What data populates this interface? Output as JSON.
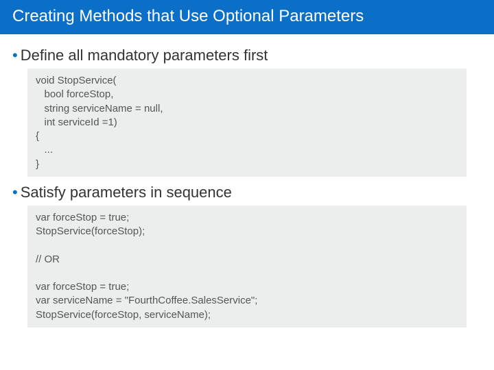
{
  "title": "Creating Methods that Use Optional Parameters",
  "bullets": [
    {
      "text": "Define all mandatory parameters first"
    },
    {
      "text": "Satisfy parameters in sequence"
    }
  ],
  "code1": "void StopService(\n   bool forceStop,\n   string serviceName = null,\n   int serviceId =1)\n{\n   ...\n}",
  "code2": "var forceStop = true;\nStopService(forceStop);\n\n// OR\n\nvar forceStop = true;\nvar serviceName = \"FourthCoffee.SalesService\";\nStopService(forceStop, serviceName);"
}
